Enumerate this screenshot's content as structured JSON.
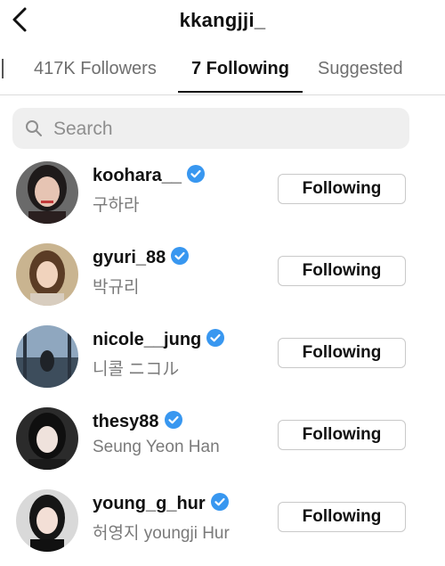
{
  "header": {
    "title": "kkangjji_"
  },
  "tabs": [
    {
      "label": "417K Followers"
    },
    {
      "label": "7 Following"
    },
    {
      "label": "Suggested"
    }
  ],
  "search": {
    "placeholder": "Search",
    "value": ""
  },
  "users": [
    {
      "username": "koohara__",
      "fullname": "구하라",
      "verified": true,
      "button_label": "Following"
    },
    {
      "username": "gyuri_88",
      "fullname": "박규리",
      "verified": true,
      "button_label": "Following"
    },
    {
      "username": "nicole__jung",
      "fullname": "니콜 ニコル",
      "verified": true,
      "button_label": "Following"
    },
    {
      "username": "thesy88",
      "fullname": "Seung Yeon Han",
      "verified": true,
      "button_label": "Following"
    },
    {
      "username": "young_g_hur",
      "fullname": "허영지 youngji Hur",
      "verified": true,
      "button_label": "Following"
    }
  ],
  "colors": {
    "verified_badge": "#3897f0",
    "tab_active": "#111111",
    "tab_inactive": "#6f6f6f",
    "search_bg": "#efefef"
  }
}
